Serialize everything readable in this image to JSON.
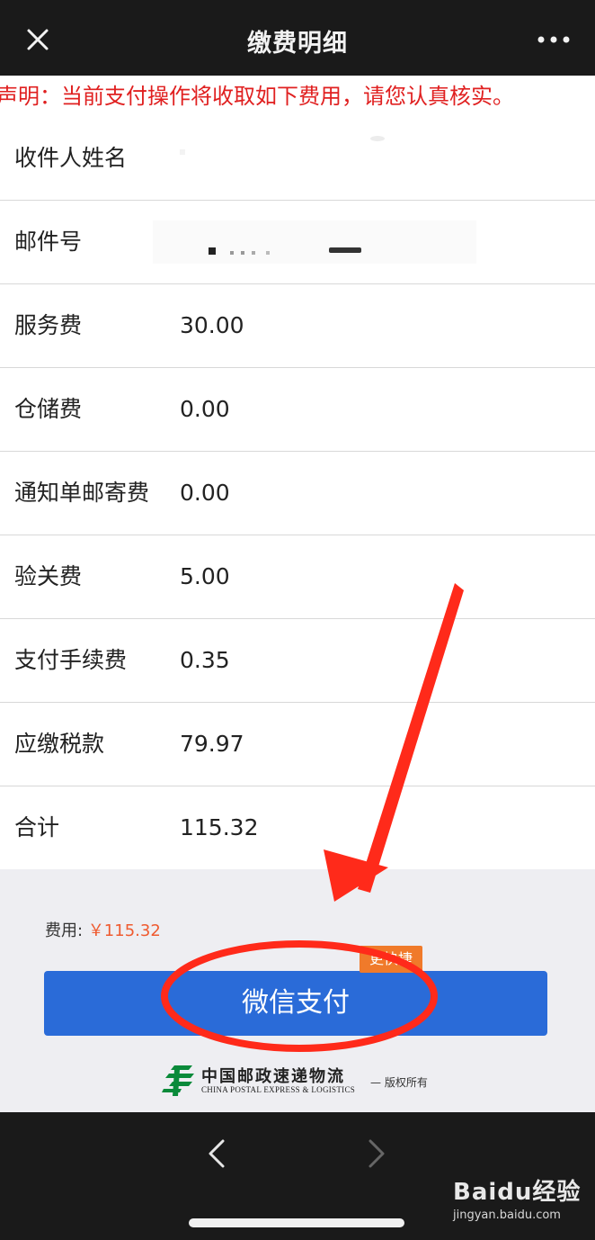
{
  "header": {
    "title": "缴费明细",
    "close_icon": "close-icon",
    "more_icon": "more-icon"
  },
  "notice": "声明：当前支付操作将收取如下费用，请您认真核实。",
  "rows": [
    {
      "label": "收件人姓名",
      "value": ""
    },
    {
      "label": "邮件号",
      "value": ""
    },
    {
      "label": "服务费",
      "value": "30.00"
    },
    {
      "label": "仓储费",
      "value": "0.00"
    },
    {
      "label": "通知单邮寄费",
      "value": "0.00"
    },
    {
      "label": "验关费",
      "value": "5.00"
    },
    {
      "label": "支付手续费",
      "value": "0.35"
    },
    {
      "label": "应缴税款",
      "value": "79.97"
    },
    {
      "label": "合计",
      "value": "115.32"
    }
  ],
  "payment": {
    "fee_label": "费用:",
    "fee_amount": "￥115.32",
    "button_label": "微信支付",
    "badge": "更快捷"
  },
  "brand": {
    "cn": "中国邮政速递物流",
    "en": "CHINA POSTAL EXPRESS & LOGISTICS",
    "rights": "— 版权所有"
  },
  "watermark": {
    "brand": "Baidu经验",
    "url": "jingyan.baidu.com"
  },
  "colors": {
    "topbar": "#1a1a1a",
    "notice_red": "#e02020",
    "button_blue": "#2a6bd8",
    "fee_orange": "#ef5a2f",
    "annotation_red": "#ff2a1a"
  }
}
